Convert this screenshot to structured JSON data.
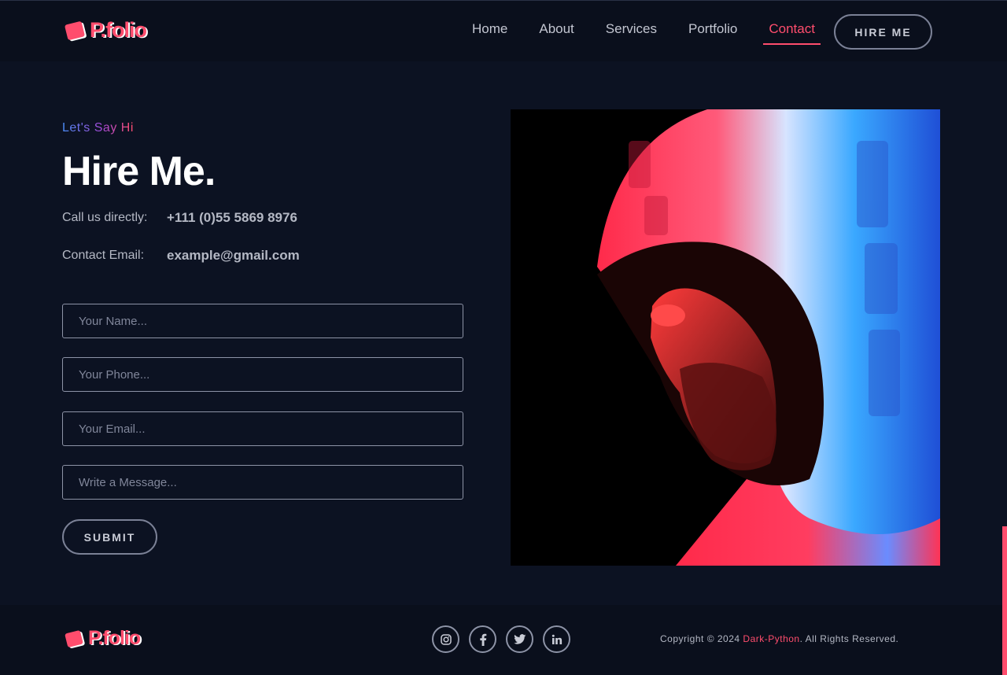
{
  "brand": {
    "logo_text": "P.folio",
    "accent_color": "#ff4d6d"
  },
  "nav": {
    "items": [
      {
        "label": "Home"
      },
      {
        "label": "About"
      },
      {
        "label": "Services"
      },
      {
        "label": "Portfolio"
      },
      {
        "label": "Contact",
        "active": true
      }
    ],
    "cta_label": "HIRE ME"
  },
  "contact": {
    "eyebrow": "Let's Say Hi",
    "title": "Hire Me.",
    "call_label": "Call us directly:",
    "call_value": "+111 (0)55 5869 8976",
    "email_label": "Contact Email:",
    "email_value": "example@gmail.com"
  },
  "form": {
    "name_placeholder": "Your Name...",
    "phone_placeholder": "Your Phone...",
    "email_placeholder": "Your Email...",
    "message_placeholder": "Write a Message...",
    "submit_label": "SUBMIT"
  },
  "footer": {
    "logo_text": "P.folio",
    "socials": [
      "instagram-icon",
      "facebook-icon",
      "twitter-icon",
      "linkedin-icon"
    ],
    "copyright_prefix": "Copyright © 2024 ",
    "copyright_brand": "Dark-Python",
    "copyright_suffix": ". All Rights Reserved."
  }
}
